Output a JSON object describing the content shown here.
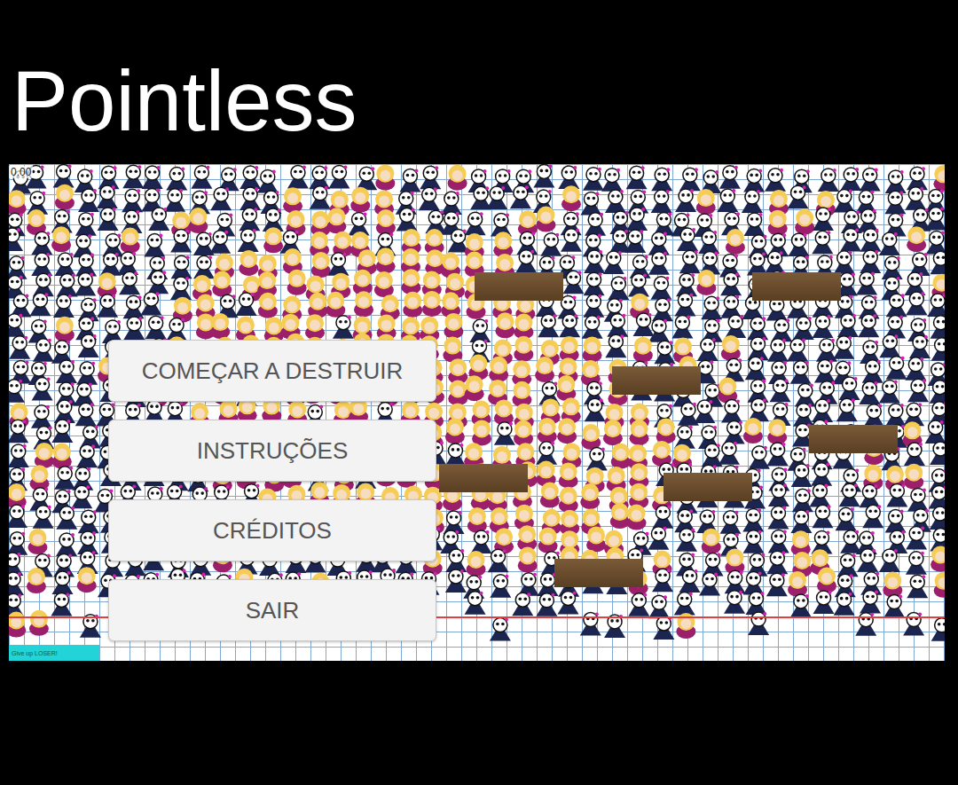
{
  "window": {
    "title": "Pointless"
  },
  "hud": {
    "timer": "0.00"
  },
  "menu": {
    "buttons": [
      {
        "label": "COMEÇAR A DESTRUIR"
      },
      {
        "label": "INSTRUÇÕES"
      },
      {
        "label": "CRÉDITOS"
      },
      {
        "label": "SAIR"
      }
    ]
  },
  "give_up": {
    "label": "Give up LOSER!"
  }
}
